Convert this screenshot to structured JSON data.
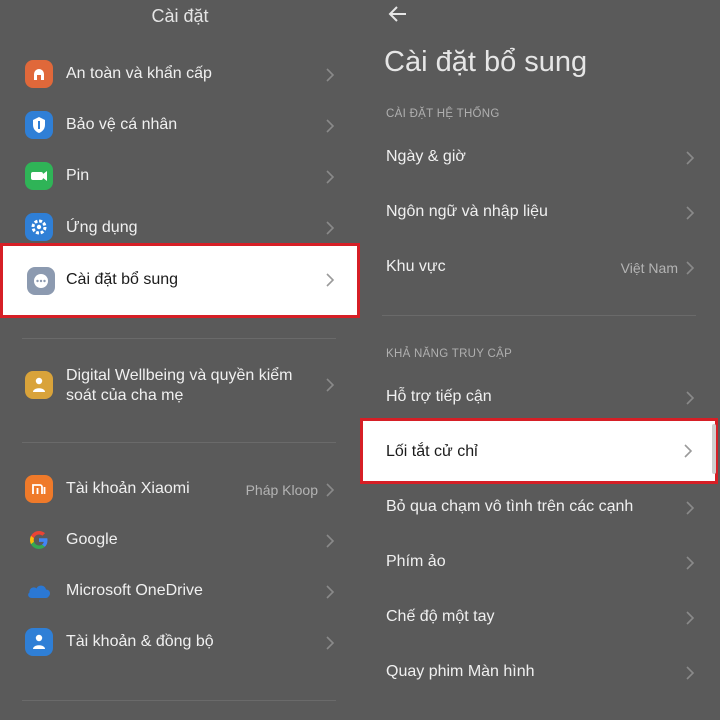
{
  "left_panel": {
    "title": "Cài đặt",
    "items": [
      {
        "label": "An toàn và khẩn cấp",
        "icon": "emergency-icon",
        "color": "#e0683a"
      },
      {
        "label": "Bảo vệ cá nhân",
        "icon": "privacy-shield-icon",
        "color": "#2f7fd6"
      },
      {
        "label": "Pin",
        "icon": "battery-icon",
        "color": "#2fb457"
      },
      {
        "label": "Ứng dụng",
        "icon": "gear-icon",
        "color": "#2f7fd6"
      },
      {
        "label": "Cài đặt bổ sung",
        "icon": "more-dots-icon",
        "color": "#8c9ab0"
      },
      {
        "label": "Digital Wellbeing và quyền kiểm soát của cha mẹ",
        "icon": "wellbeing-icon",
        "color": "#d9a33a"
      },
      {
        "label": "Tài khoản Xiaomi",
        "value": "Pháp Kloop",
        "icon": "xiaomi-mi-icon",
        "color": "#ef7a2a"
      },
      {
        "label": "Google",
        "icon": "google-icon"
      },
      {
        "label": "Microsoft OneDrive",
        "icon": "onedrive-cloud-icon",
        "color": "#2b78d4"
      },
      {
        "label": "Tài khoản & đồng bộ",
        "icon": "account-sync-icon",
        "color": "#2f7fd6"
      }
    ]
  },
  "right_panel": {
    "title": "Cài đặt bổ sung",
    "sections": [
      {
        "header": "CÀI ĐẶT HỆ THỐNG",
        "items": [
          {
            "label": "Ngày & giờ"
          },
          {
            "label": "Ngôn ngữ và nhập liệu"
          },
          {
            "label": "Khu vực",
            "value": "Việt Nam"
          }
        ]
      },
      {
        "header": "KHẢ NĂNG TRUY CẬP",
        "items": [
          {
            "label": "Hỗ trợ tiếp cận"
          },
          {
            "label": "Lối tắt cử chỉ"
          },
          {
            "label": "Bỏ qua chạm vô tình trên các cạnh"
          },
          {
            "label": "Phím ảo"
          },
          {
            "label": "Chế độ một tay"
          },
          {
            "label": "Quay phim Màn hình"
          }
        ]
      }
    ]
  },
  "highlight_color": "#d61f26"
}
